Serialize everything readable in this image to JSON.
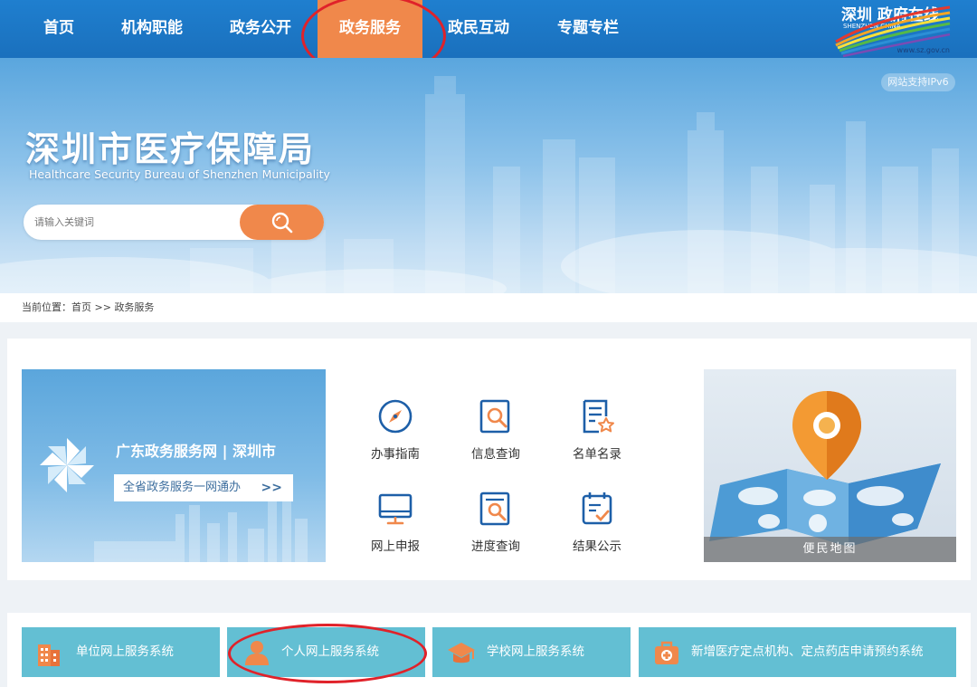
{
  "colors": {
    "nav_blue": "#1f7fcf",
    "accent_orange": "#f0884b",
    "sys_teal": "#63bfd3",
    "annotation_red": "#e0222a"
  },
  "nav": {
    "items": [
      {
        "label": "首页"
      },
      {
        "label": "机构职能"
      },
      {
        "label": "政务公开"
      },
      {
        "label": "政务服务",
        "active": true
      },
      {
        "label": "政民互动"
      },
      {
        "label": "专题专栏"
      }
    ],
    "logo": {
      "url": "www.sz.gov.cn",
      "cn": "深圳 政府在线",
      "en": "SHENZHEN CHINA"
    }
  },
  "banner": {
    "ipv6": "网站支持IPv6",
    "title": "深圳市医疗保障局",
    "subtitle": "Healthcare Security Bureau of Shenzhen Municipality",
    "search": {
      "placeholder": "请输入关键词",
      "button_icon": "search-icon"
    }
  },
  "breadcrumb": {
    "prefix": "当前位置：",
    "home": "首页",
    "separator": ">>",
    "current": "政务服务"
  },
  "promo": {
    "title": "广东政务服务网 | 深圳市",
    "button": "全省政务服务一网通办",
    "button_icon": "double-chevron-right-icon"
  },
  "services": [
    {
      "label": "办事指南",
      "icon": "compass-icon"
    },
    {
      "label": "信息查询",
      "icon": "search-document-icon"
    },
    {
      "label": "名单名录",
      "icon": "list-star-icon"
    },
    {
      "label": "网上申报",
      "icon": "monitor-icon"
    },
    {
      "label": "进度查询",
      "icon": "progress-search-icon"
    },
    {
      "label": "结果公示",
      "icon": "calendar-check-icon"
    }
  ],
  "map": {
    "label": "便民地图",
    "icon": "map-pin-icon"
  },
  "systems": [
    {
      "label": "单位网上服务系统",
      "icon": "building-icon"
    },
    {
      "label": "个人网上服务系统",
      "icon": "person-icon"
    },
    {
      "label": "学校网上服务系统",
      "icon": "graduation-cap-icon"
    },
    {
      "label": "新增医疗定点机构、定点药店申请预约系统",
      "icon": "medical-kit-icon"
    }
  ]
}
